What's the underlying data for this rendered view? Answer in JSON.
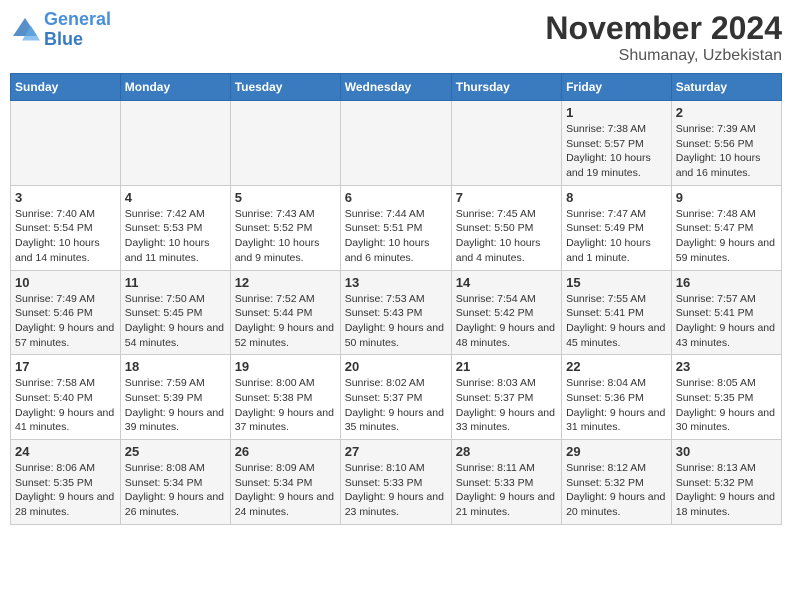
{
  "header": {
    "logo_line1": "General",
    "logo_line2": "Blue",
    "month": "November 2024",
    "location": "Shumanay, Uzbekistan"
  },
  "weekdays": [
    "Sunday",
    "Monday",
    "Tuesday",
    "Wednesday",
    "Thursday",
    "Friday",
    "Saturday"
  ],
  "weeks": [
    [
      {
        "day": "",
        "info": ""
      },
      {
        "day": "",
        "info": ""
      },
      {
        "day": "",
        "info": ""
      },
      {
        "day": "",
        "info": ""
      },
      {
        "day": "",
        "info": ""
      },
      {
        "day": "1",
        "info": "Sunrise: 7:38 AM\nSunset: 5:57 PM\nDaylight: 10 hours and 19 minutes."
      },
      {
        "day": "2",
        "info": "Sunrise: 7:39 AM\nSunset: 5:56 PM\nDaylight: 10 hours and 16 minutes."
      }
    ],
    [
      {
        "day": "3",
        "info": "Sunrise: 7:40 AM\nSunset: 5:54 PM\nDaylight: 10 hours and 14 minutes."
      },
      {
        "day": "4",
        "info": "Sunrise: 7:42 AM\nSunset: 5:53 PM\nDaylight: 10 hours and 11 minutes."
      },
      {
        "day": "5",
        "info": "Sunrise: 7:43 AM\nSunset: 5:52 PM\nDaylight: 10 hours and 9 minutes."
      },
      {
        "day": "6",
        "info": "Sunrise: 7:44 AM\nSunset: 5:51 PM\nDaylight: 10 hours and 6 minutes."
      },
      {
        "day": "7",
        "info": "Sunrise: 7:45 AM\nSunset: 5:50 PM\nDaylight: 10 hours and 4 minutes."
      },
      {
        "day": "8",
        "info": "Sunrise: 7:47 AM\nSunset: 5:49 PM\nDaylight: 10 hours and 1 minute."
      },
      {
        "day": "9",
        "info": "Sunrise: 7:48 AM\nSunset: 5:47 PM\nDaylight: 9 hours and 59 minutes."
      }
    ],
    [
      {
        "day": "10",
        "info": "Sunrise: 7:49 AM\nSunset: 5:46 PM\nDaylight: 9 hours and 57 minutes."
      },
      {
        "day": "11",
        "info": "Sunrise: 7:50 AM\nSunset: 5:45 PM\nDaylight: 9 hours and 54 minutes."
      },
      {
        "day": "12",
        "info": "Sunrise: 7:52 AM\nSunset: 5:44 PM\nDaylight: 9 hours and 52 minutes."
      },
      {
        "day": "13",
        "info": "Sunrise: 7:53 AM\nSunset: 5:43 PM\nDaylight: 9 hours and 50 minutes."
      },
      {
        "day": "14",
        "info": "Sunrise: 7:54 AM\nSunset: 5:42 PM\nDaylight: 9 hours and 48 minutes."
      },
      {
        "day": "15",
        "info": "Sunrise: 7:55 AM\nSunset: 5:41 PM\nDaylight: 9 hours and 45 minutes."
      },
      {
        "day": "16",
        "info": "Sunrise: 7:57 AM\nSunset: 5:41 PM\nDaylight: 9 hours and 43 minutes."
      }
    ],
    [
      {
        "day": "17",
        "info": "Sunrise: 7:58 AM\nSunset: 5:40 PM\nDaylight: 9 hours and 41 minutes."
      },
      {
        "day": "18",
        "info": "Sunrise: 7:59 AM\nSunset: 5:39 PM\nDaylight: 9 hours and 39 minutes."
      },
      {
        "day": "19",
        "info": "Sunrise: 8:00 AM\nSunset: 5:38 PM\nDaylight: 9 hours and 37 minutes."
      },
      {
        "day": "20",
        "info": "Sunrise: 8:02 AM\nSunset: 5:37 PM\nDaylight: 9 hours and 35 minutes."
      },
      {
        "day": "21",
        "info": "Sunrise: 8:03 AM\nSunset: 5:37 PM\nDaylight: 9 hours and 33 minutes."
      },
      {
        "day": "22",
        "info": "Sunrise: 8:04 AM\nSunset: 5:36 PM\nDaylight: 9 hours and 31 minutes."
      },
      {
        "day": "23",
        "info": "Sunrise: 8:05 AM\nSunset: 5:35 PM\nDaylight: 9 hours and 30 minutes."
      }
    ],
    [
      {
        "day": "24",
        "info": "Sunrise: 8:06 AM\nSunset: 5:35 PM\nDaylight: 9 hours and 28 minutes."
      },
      {
        "day": "25",
        "info": "Sunrise: 8:08 AM\nSunset: 5:34 PM\nDaylight: 9 hours and 26 minutes."
      },
      {
        "day": "26",
        "info": "Sunrise: 8:09 AM\nSunset: 5:34 PM\nDaylight: 9 hours and 24 minutes."
      },
      {
        "day": "27",
        "info": "Sunrise: 8:10 AM\nSunset: 5:33 PM\nDaylight: 9 hours and 23 minutes."
      },
      {
        "day": "28",
        "info": "Sunrise: 8:11 AM\nSunset: 5:33 PM\nDaylight: 9 hours and 21 minutes."
      },
      {
        "day": "29",
        "info": "Sunrise: 8:12 AM\nSunset: 5:32 PM\nDaylight: 9 hours and 20 minutes."
      },
      {
        "day": "30",
        "info": "Sunrise: 8:13 AM\nSunset: 5:32 PM\nDaylight: 9 hours and 18 minutes."
      }
    ]
  ]
}
